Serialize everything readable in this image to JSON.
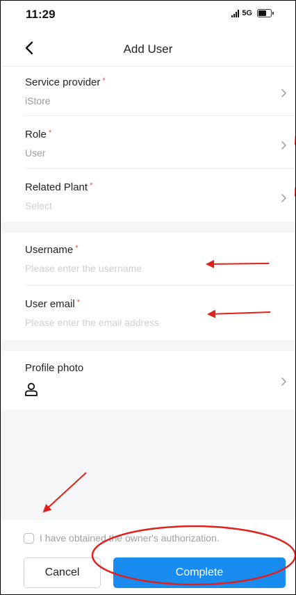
{
  "status_bar": {
    "time": "11:29",
    "network": "5G",
    "battery_icon": "battery-icon",
    "signal_icon": "signal-icon"
  },
  "header": {
    "title": "Add User",
    "back_icon": "chevron-left-icon"
  },
  "form": {
    "service_provider": {
      "label": "Service provider",
      "required_mark": "*",
      "value": "iStore"
    },
    "role": {
      "label": "Role",
      "required_mark": "*",
      "value": "User"
    },
    "related_plant": {
      "label": "Related Plant",
      "required_mark": "*",
      "placeholder": "Select"
    },
    "username": {
      "label": "Username",
      "required_mark": "*",
      "placeholder": "Please enter the username"
    },
    "user_email": {
      "label": "User email",
      "required_mark": "*",
      "placeholder": "Please enter the email address"
    },
    "profile_photo": {
      "label": "Profile photo",
      "icon": "person-icon"
    }
  },
  "footer": {
    "consent_text": "I have obtained the owner's authorization.",
    "cancel_label": "Cancel",
    "complete_label": "Complete"
  },
  "colors": {
    "accent": "#1a8cf0",
    "required": "#f04b4b",
    "annotation": "#e0201a",
    "section_gap": "#f5f6f8"
  }
}
